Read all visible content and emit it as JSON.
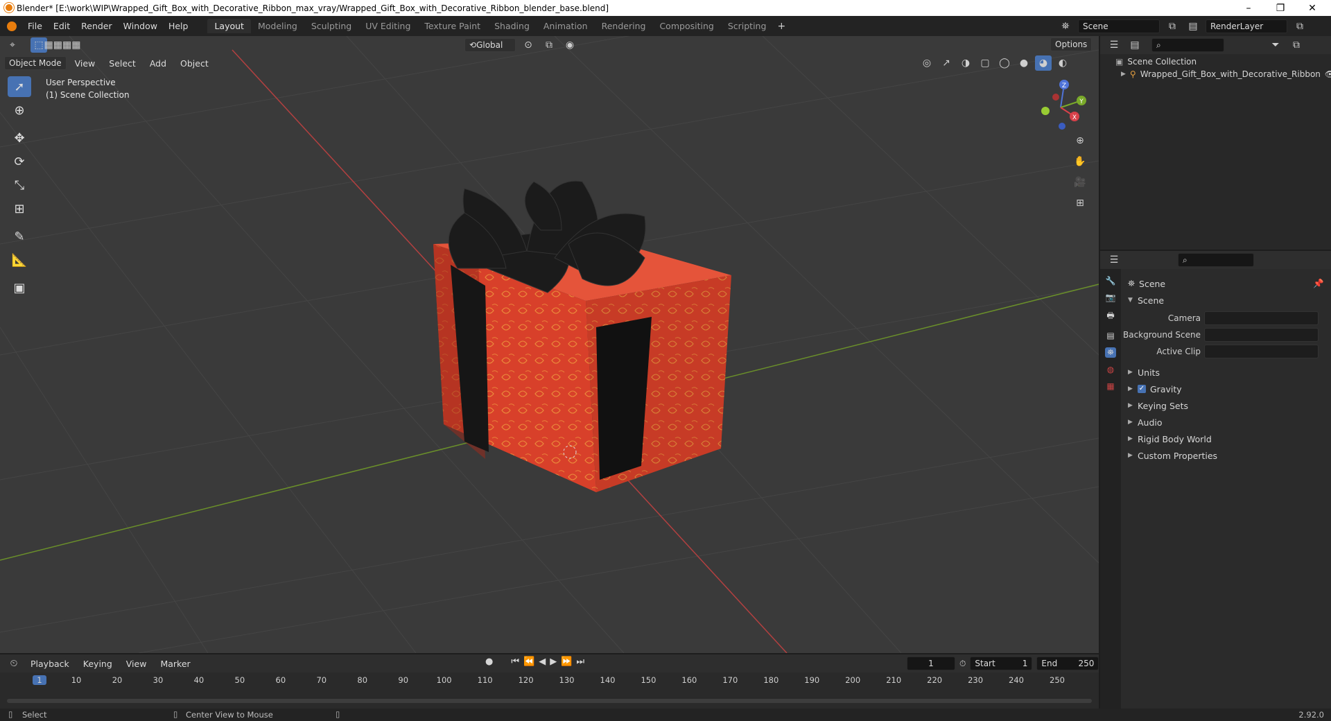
{
  "window": {
    "title": "Blender* [E:\\work\\WIP\\Wrapped_Gift_Box_with_Decorative_Ribbon_max_vray/Wrapped_Gift_Box_with_Decorative_Ribbon_blender_base.blend]",
    "minimize": "–",
    "restore": "❐",
    "close": "✕"
  },
  "menu": [
    "File",
    "Edit",
    "Render",
    "Window",
    "Help"
  ],
  "workspaces": [
    "Layout",
    "Modeling",
    "Sculpting",
    "UV Editing",
    "Texture Paint",
    "Shading",
    "Animation",
    "Rendering",
    "Compositing",
    "Scripting"
  ],
  "active_workspace": "Layout",
  "scene_field": "Scene",
  "renderlayer_field": "RenderLayer",
  "viewport": {
    "mode": "Object Mode",
    "menus": [
      "View",
      "Select",
      "Add",
      "Object"
    ],
    "orientation": "Global",
    "options": "Options",
    "overlay_line1": "User Perspective",
    "overlay_line2": "(1) Scene Collection",
    "gizmo": {
      "z": "Z",
      "y": "Y",
      "x": "X"
    }
  },
  "outliner": {
    "root": "Scene Collection",
    "item": "Wrapped_Gift_Box_with_Decorative_Ribbon"
  },
  "properties": {
    "header": "Scene",
    "panel": "Scene",
    "camera_label": "Camera",
    "bg_scene_label": "Background Scene",
    "active_clip_label": "Active Clip",
    "sections": [
      "Units",
      "Gravity",
      "Keying Sets",
      "Audio",
      "Rigid Body World",
      "Custom Properties"
    ],
    "gravity_checked": true
  },
  "timeline": {
    "menus": [
      "Playback",
      "Keying",
      "View",
      "Marker"
    ],
    "current_frame": "1",
    "start_label": "Start",
    "start": "1",
    "end_label": "End",
    "end": "250",
    "ticks": [
      "1",
      "10",
      "20",
      "30",
      "40",
      "50",
      "60",
      "70",
      "80",
      "90",
      "100",
      "110",
      "120",
      "130",
      "140",
      "150",
      "160",
      "170",
      "180",
      "190",
      "200",
      "210",
      "220",
      "230",
      "240",
      "250"
    ]
  },
  "status": {
    "left": "Select",
    "middle": "Center View to Mouse",
    "version": "2.92.0"
  },
  "colors": {
    "accent": "#4772b3",
    "gift": "#d8402a",
    "ribbon": "#141414",
    "x_axis": "#a33",
    "y_axis": "#6a8f2a"
  }
}
